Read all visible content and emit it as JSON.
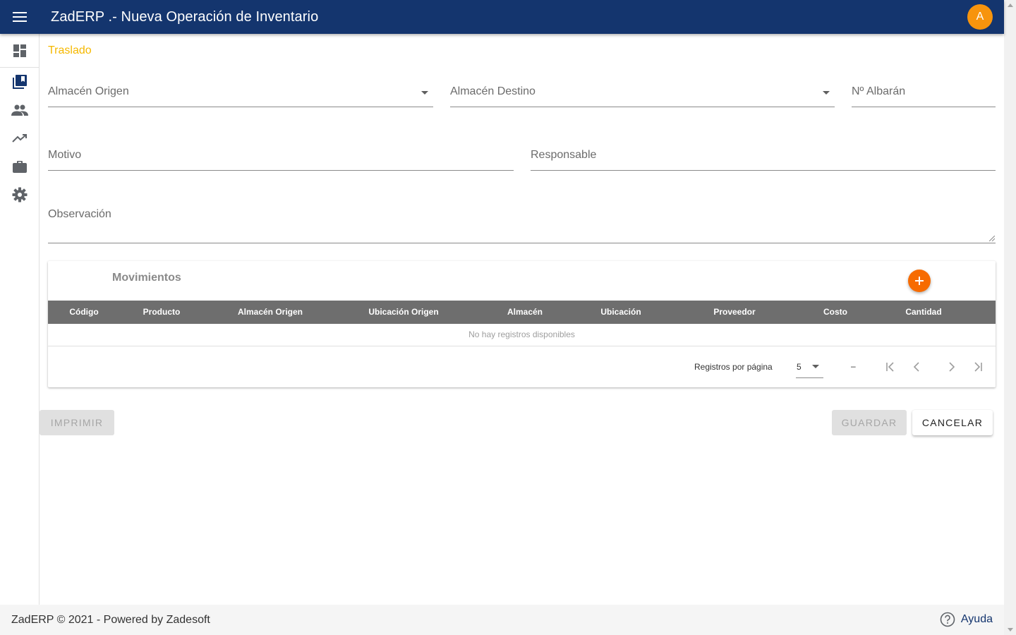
{
  "header": {
    "title": "ZadERP .- Nueva Operación de Inventario",
    "avatar_initial": "A",
    "brand_color": "#14356e",
    "avatar_color": "#f7940d"
  },
  "sidebar": {
    "items": [
      {
        "icon": "dashboard-icon"
      },
      {
        "icon": "library-books-icon"
      },
      {
        "icon": "people-icon"
      },
      {
        "icon": "trending-up-icon"
      },
      {
        "icon": "briefcase-icon"
      },
      {
        "icon": "settings-icon"
      }
    ]
  },
  "form": {
    "operation_type": "Traslado",
    "almacen_origen_label": "Almacén Origen",
    "almacen_destino_label": "Almacén Destino",
    "albaran_label": "Nº Albarán",
    "motivo_label": "Motivo",
    "responsable_label": "Responsable",
    "observacion_label": "Observación"
  },
  "movements": {
    "title": "Movimientos",
    "add_icon": "plus-icon",
    "columns": [
      "Código",
      "Producto",
      "Almacén Origen",
      "Ubicación Origen",
      "Almacén",
      "Ubicación",
      "Proveedor",
      "Costo",
      "Cantidad"
    ],
    "empty_message": "No hay registros disponibles",
    "pagination": {
      "rows_per_page_label": "Registros por página",
      "rows_per_page": "5",
      "range": "–"
    }
  },
  "actions": {
    "print_label": "IMPRIMIR",
    "save_label": "GUARDAR",
    "cancel_label": "CANCELAR"
  },
  "footer": {
    "copyright": "ZadERP © 2021 - Powered by Zadesoft",
    "help_label": "Ayuda"
  }
}
